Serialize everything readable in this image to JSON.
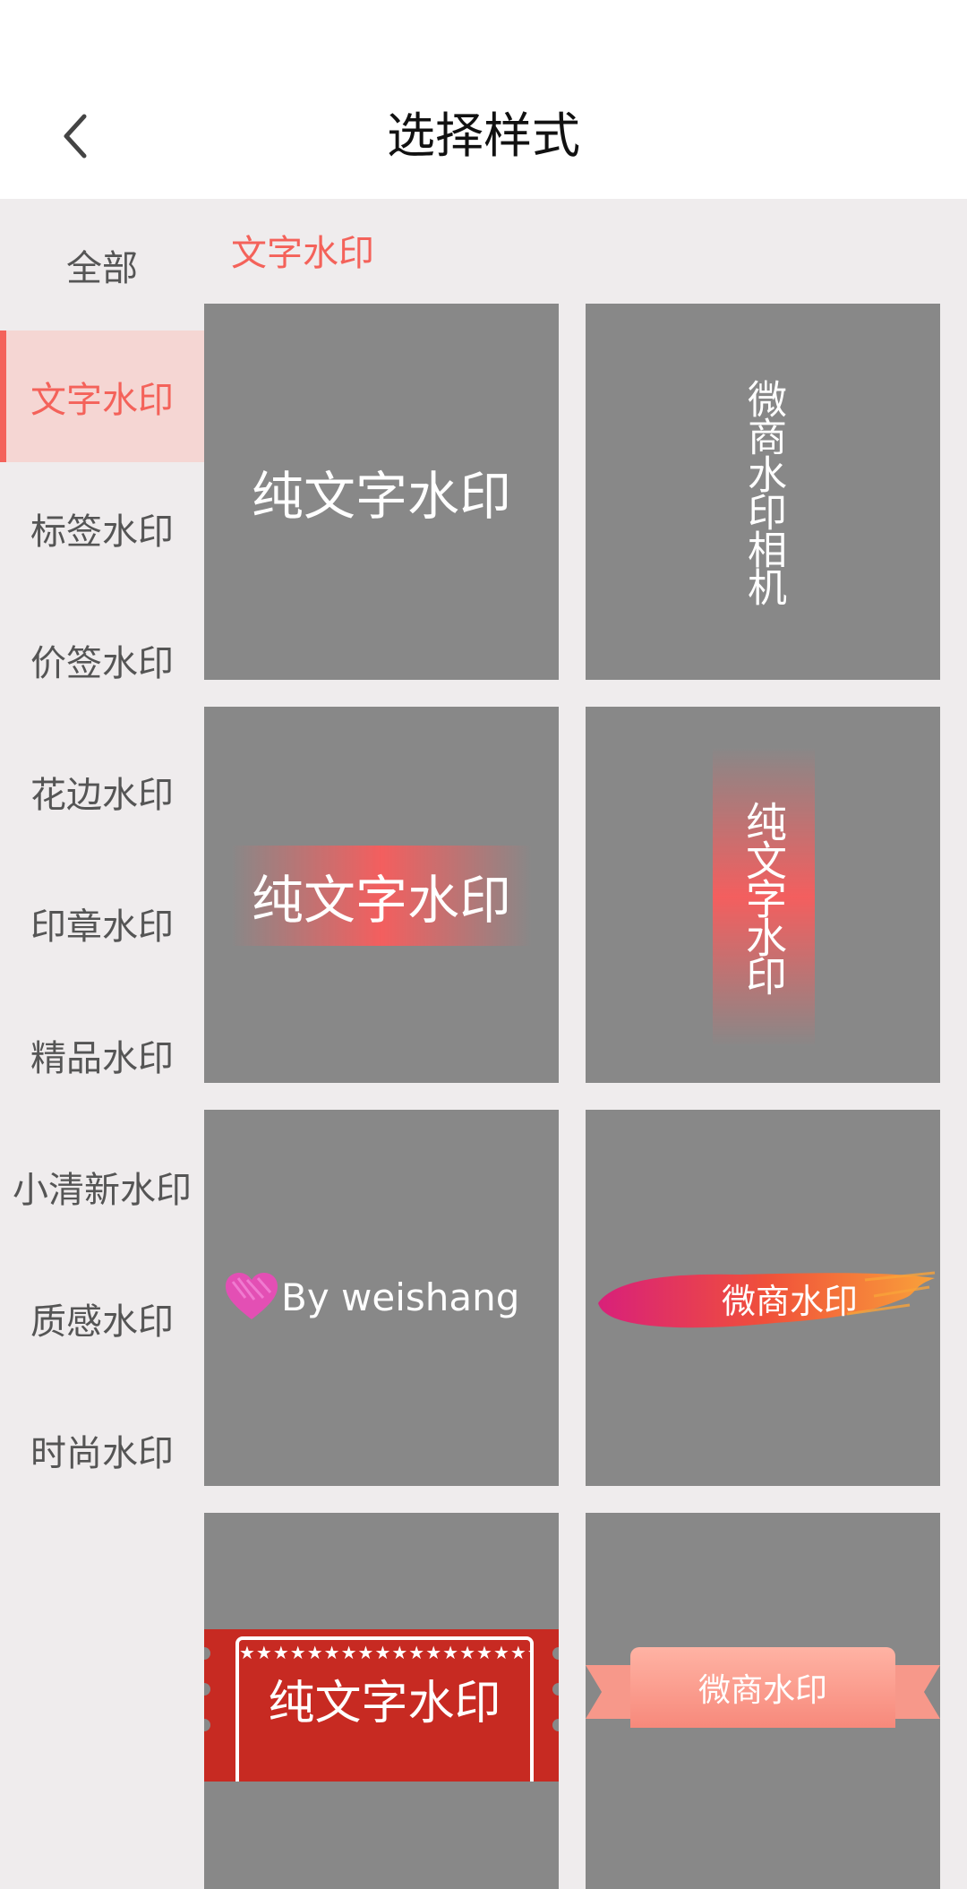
{
  "header": {
    "title": "选择样式",
    "back_icon": "chevron-left-icon"
  },
  "sidebar": {
    "active_index": 1,
    "items": [
      {
        "label": "全部"
      },
      {
        "label": "文字水印"
      },
      {
        "label": "标签水印"
      },
      {
        "label": "价签水印"
      },
      {
        "label": "花边水印"
      },
      {
        "label": "印章水印"
      },
      {
        "label": "精品水印"
      },
      {
        "label": "小清新水印"
      },
      {
        "label": "质感水印"
      },
      {
        "label": "时尚水印"
      }
    ]
  },
  "content": {
    "section_title": "文字水印",
    "tiles": [
      {
        "text": "纯文字水印"
      },
      {
        "text": "微商水印相机"
      },
      {
        "text": "纯文字水印"
      },
      {
        "text": "纯文字水印"
      },
      {
        "text": "By weishang"
      },
      {
        "text": "微商水印"
      },
      {
        "text": "纯文字水印"
      },
      {
        "text": "微商水印"
      }
    ]
  },
  "colors": {
    "accent": "#f4625a",
    "active_bg": "#f5d6d3",
    "tile_bg": "#888888",
    "page_bg": "#efeced"
  }
}
